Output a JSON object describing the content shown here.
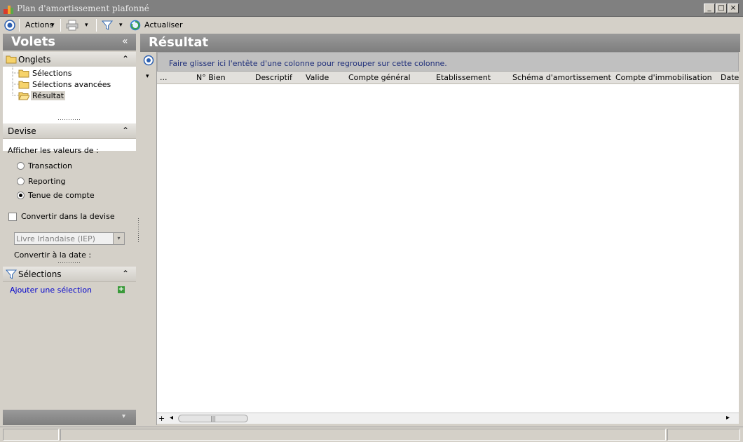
{
  "window": {
    "title": "Plan d'amortissement plafonné",
    "controls": {
      "minimize": "_",
      "maximize": "□",
      "close": "×"
    }
  },
  "toolbar": {
    "actions_label": "Actions",
    "refresh_label": "Actualiser",
    "dropdown_glyph": "▾"
  },
  "left_panel": {
    "title": "Volets",
    "collapse_glyph": "«",
    "tabs_section": {
      "title": "Onglets",
      "chevron": "⌃",
      "items": [
        {
          "label": "Sélections"
        },
        {
          "label": "Sélections avancées"
        },
        {
          "label": "Résultat",
          "selected": true
        }
      ]
    },
    "currency_section": {
      "title": "Devise",
      "chevron": "⌃",
      "show_values_label": "Afficher les valeurs de :",
      "options": [
        {
          "label": "Transaction",
          "checked": false
        },
        {
          "label": "Reporting",
          "checked": false
        },
        {
          "label": "Tenue de compte",
          "checked": true
        }
      ],
      "convert_label": "Convertir dans la devise",
      "convert_checked": false,
      "currency_value": "Livre Irlandaise (IEP)",
      "convert_date_label": "Convertir à la date :"
    },
    "selections_section": {
      "title": "Sélections",
      "chevron": "⌃",
      "add_label": "Ajouter une sélection",
      "add_glyph": "+"
    },
    "bottom_glyph": "▾"
  },
  "result_panel": {
    "title": "Résultat",
    "group_hint": "Faire glisser ici l'entête d'une colonne pour regrouper sur cette colonne.",
    "row_menu_glyph": "▾",
    "columns": [
      "...",
      "N° Bien",
      "Descriptif",
      "Valide",
      "Compte général",
      "Etablissement",
      "Schéma d'amortissement",
      "Compte d'immobilisation",
      "Date"
    ],
    "scroll": {
      "add_glyph": "+",
      "left_glyph": "◂",
      "right_glyph": "▸",
      "thumb_glyph": "|||"
    }
  },
  "colors": {
    "header_gray": "#8c8c8c",
    "link_blue": "#0000cc",
    "group_text": "#1f2f7a",
    "green_add": "#3a9a3a"
  }
}
